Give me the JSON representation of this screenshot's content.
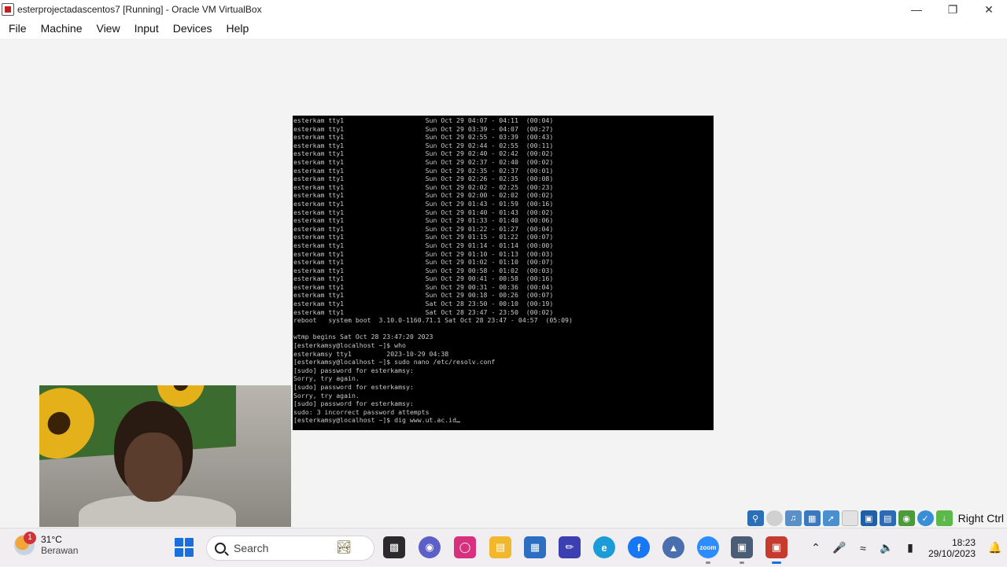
{
  "window": {
    "title": "esterprojectadascentos7 [Running] - Oracle VM VirtualBox"
  },
  "menu": [
    "File",
    "Machine",
    "View",
    "Input",
    "Devices",
    "Help"
  ],
  "console_lines": [
    "esterkam tty1                     Sun Oct 29 04:07 - 04:11  (00:04)",
    "esterkam tty1                     Sun Oct 29 03:39 - 04:07  (00:27)",
    "esterkam tty1                     Sun Oct 29 02:55 - 03:39  (00:43)",
    "esterkam tty1                     Sun Oct 29 02:44 - 02:55  (00:11)",
    "esterkam tty1                     Sun Oct 29 02:40 - 02:42  (00:02)",
    "esterkam tty1                     Sun Oct 29 02:37 - 02:40  (00:02)",
    "esterkam tty1                     Sun Oct 29 02:35 - 02:37  (00:01)",
    "esterkam tty1                     Sun Oct 29 02:26 - 02:35  (00:08)",
    "esterkam tty1                     Sun Oct 29 02:02 - 02:25  (00:23)",
    "esterkam tty1                     Sun Oct 29 02:00 - 02:02  (00:02)",
    "esterkam tty1                     Sun Oct 29 01:43 - 01:59  (00:16)",
    "esterkam tty1                     Sun Oct 29 01:40 - 01:43  (00:02)",
    "esterkam tty1                     Sun Oct 29 01:33 - 01:40  (00:06)",
    "esterkam tty1                     Sun Oct 29 01:22 - 01:27  (00:04)",
    "esterkam tty1                     Sun Oct 29 01:15 - 01:22  (00:07)",
    "esterkam tty1                     Sun Oct 29 01:14 - 01:14  (00:00)",
    "esterkam tty1                     Sun Oct 29 01:10 - 01:13  (00:03)",
    "esterkam tty1                     Sun Oct 29 01:02 - 01:10  (00:07)",
    "esterkam tty1                     Sun Oct 29 00:58 - 01:02  (00:03)",
    "esterkam tty1                     Sun Oct 29 00:41 - 00:58  (00:16)",
    "esterkam tty1                     Sun Oct 29 00:31 - 00:36  (00:04)",
    "esterkam tty1                     Sun Oct 29 00:18 - 00:26  (00:07)",
    "esterkam tty1                     Sat Oct 28 23:50 - 00:10  (00:19)",
    "esterkam tty1                     Sat Oct 28 23:47 - 23:50  (00:02)",
    "reboot   system boot  3.10.0-1160.71.1 Sat Oct 28 23:47 - 04:57  (05:09)",
    "",
    "wtmp begins Sat Oct 28 23:47:20 2023",
    "[esterkamsy@localhost ~]$ who",
    "esterkamsy tty1         2023-10-29 04:38",
    "[esterkamsy@localhost ~]$ sudo nano /etc/resolv.conf",
    "[sudo] password for esterkamsy:",
    "Sorry, try again.",
    "[sudo] password for esterkamsy:",
    "Sorry, try again.",
    "[sudo] password for esterkamsy:",
    "sudo: 3 incorrect password attempts",
    "[esterkamsy@localhost ~]$ dig www.ut.ac.id"
  ],
  "vbox_status": {
    "icons": [
      "storage-icon",
      "optical-icon",
      "audio-icon",
      "network-icon",
      "usb-icon",
      "shared-folders-icon",
      "display-icon",
      "capture-icon",
      "recording-icon",
      "keyboard-icon",
      "mouse-icon",
      "arrow-icon"
    ],
    "host_key": "Right Ctrl"
  },
  "taskbar": {
    "weather_badge": "1",
    "temperature": "31°C",
    "condition": "Berawan",
    "search_placeholder": "Search",
    "time": "18:23",
    "date": "29/10/2023"
  },
  "colors": {
    "console_bg": "#000000",
    "console_fg": "#c9c9c9",
    "taskbar_bg": "#f0eef0",
    "accent": "#1a6fdc"
  }
}
